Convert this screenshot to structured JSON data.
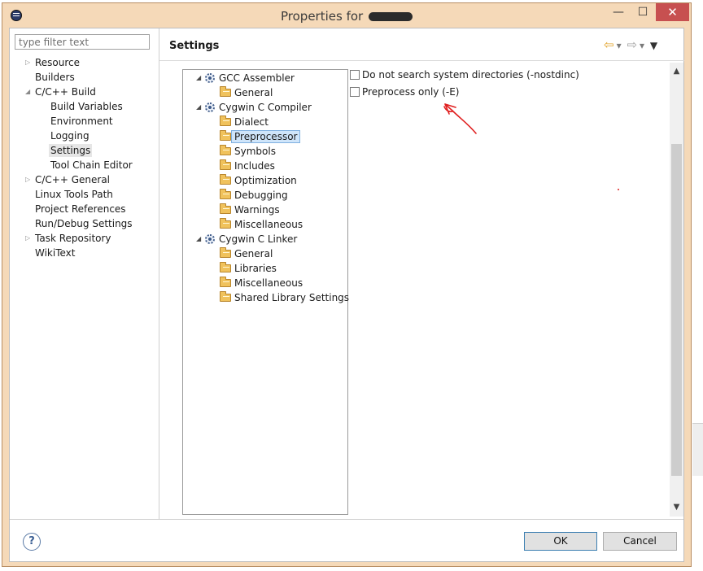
{
  "window": {
    "title": "Properties for",
    "minimize_glyph": "—",
    "maximize_glyph": "☐",
    "close_glyph": "✕"
  },
  "filter": {
    "placeholder": "type filter text"
  },
  "nav": {
    "items": [
      {
        "label": "Resource",
        "expander": "collapsed"
      },
      {
        "label": "Builders"
      },
      {
        "label": "C/C++ Build",
        "expander": "expanded"
      },
      {
        "label": "Build Variables"
      },
      {
        "label": "Environment"
      },
      {
        "label": "Logging"
      },
      {
        "label": "Settings",
        "selected": true
      },
      {
        "label": "Tool Chain Editor"
      },
      {
        "label": "C/C++ General",
        "expander": "collapsed"
      },
      {
        "label": "Linux Tools Path"
      },
      {
        "label": "Project References"
      },
      {
        "label": "Run/Debug Settings"
      },
      {
        "label": "Task Repository",
        "expander": "collapsed"
      },
      {
        "label": "WikiText"
      }
    ]
  },
  "header": {
    "title": "Settings"
  },
  "tree": {
    "items": [
      {
        "label": "GCC Assembler",
        "type": "tool"
      },
      {
        "label": "General",
        "type": "option"
      },
      {
        "label": "Cygwin C Compiler",
        "type": "tool"
      },
      {
        "label": "Dialect",
        "type": "option"
      },
      {
        "label": "Preprocessor",
        "type": "option",
        "selected": true
      },
      {
        "label": "Symbols",
        "type": "option"
      },
      {
        "label": "Includes",
        "type": "option"
      },
      {
        "label": "Optimization",
        "type": "option"
      },
      {
        "label": "Debugging",
        "type": "option"
      },
      {
        "label": "Warnings",
        "type": "option"
      },
      {
        "label": "Miscellaneous",
        "type": "option"
      },
      {
        "label": "Cygwin C Linker",
        "type": "tool"
      },
      {
        "label": "General",
        "type": "option"
      },
      {
        "label": "Libraries",
        "type": "option"
      },
      {
        "label": "Miscellaneous",
        "type": "option"
      },
      {
        "label": "Shared Library Settings",
        "type": "option"
      }
    ]
  },
  "options": [
    {
      "label": "Do not search system directories (-nostdinc)",
      "checked": false
    },
    {
      "label": "Preprocess only (-E)",
      "checked": false
    }
  ],
  "buttons": {
    "help": "?",
    "ok": "OK",
    "cancel": "Cancel"
  },
  "colors": {
    "frame": "#f5d9b8",
    "close": "#c75050",
    "selection": "#cfe5fa",
    "annotation": "#e02020"
  }
}
